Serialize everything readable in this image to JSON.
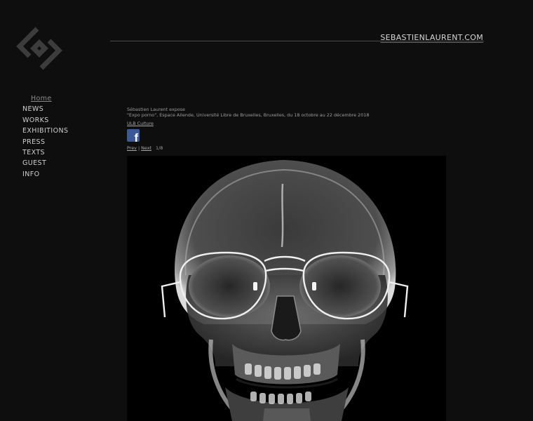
{
  "site": {
    "title": "SEBASTIENLAURENT.COM",
    "logo_icon": "diamond-monogram-logo"
  },
  "nav": {
    "items": [
      {
        "label": "Home"
      },
      {
        "label": "NEWS"
      },
      {
        "label": "WORKS"
      },
      {
        "label": "EXHIBITIONS"
      },
      {
        "label": "PRESS"
      },
      {
        "label": "TEXTS"
      },
      {
        "label": "GUEST"
      },
      {
        "label": "INFO"
      }
    ]
  },
  "exhibition": {
    "line1": "Sébastien Laurent expose",
    "line2": "\"Expo porno\", Espace Allende, Université Libre de Bruxelles, Bruxelles, du 18 octobre au 22 décembre 2018",
    "link": "ULB Culture"
  },
  "share": {
    "icon": "facebook-icon",
    "letter": "f"
  },
  "pager": {
    "prev": "Prev",
    "separator": "|",
    "next": "Next",
    "count": "1/8"
  },
  "artwork": {
    "subject": "x-ray-skull-with-aviator-glasses",
    "background": "#000000"
  }
}
